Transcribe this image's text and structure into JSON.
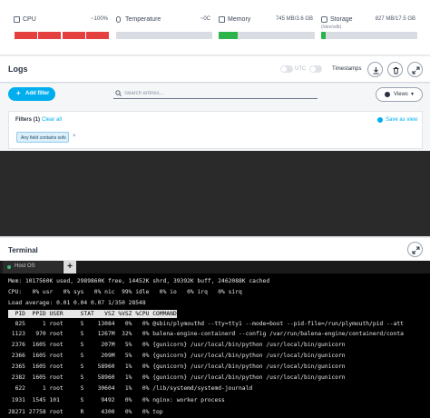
{
  "metrics": [
    {
      "name": "CPU",
      "value": "~100%",
      "sub": "",
      "percent": 100,
      "color": "#e54040",
      "segmented": true,
      "icon": "cpu-icon"
    },
    {
      "name": "Temperature",
      "value": "~0C",
      "sub": "",
      "percent": 0,
      "color": "#d9dde3",
      "segmented": false,
      "icon": "thermometer-icon"
    },
    {
      "name": "Memory",
      "value": "745 MB/3.6 GB",
      "sub": "",
      "percent": 20,
      "color": "#2bb44a",
      "segmented": false,
      "icon": "memory-icon"
    },
    {
      "name": "Storage",
      "value": "827 MB/17.5 GB",
      "sub": "(/dev/sdb)",
      "percent": 5,
      "color": "#2bb44a",
      "segmented": false,
      "icon": "storage-icon"
    }
  ],
  "logs": {
    "title": "Logs",
    "utc_label": "UTC",
    "timestamps_label": "Timestamps",
    "add_filter_label": "Add filter",
    "search_placeholder": "Search entries...",
    "views_label": "Views",
    "filters_title": "Filters (1)",
    "clear_all_label": "Clear all",
    "save_view_label": "Save as view",
    "filter_chip": "Any field contains sofs"
  },
  "terminal": {
    "title": "Terminal",
    "tab_label": "Host OS",
    "lines": [
      "Mem: 1017560K used, 2989860K free, 14452K shrd, 39392K buff, 2462088K cached",
      "CPU:   0% usr   0% sys   0% nic  99% idle   0% io   0% irq   0% sirq",
      "Load average: 0.01 0.04 0.07 1/350 28548",
      "  PID  PPID USER     STAT   VSZ %VSZ %CPU COMMAND",
      "  825     1 root     S    13084   0%   0% @sbin/plymouthd --tty=tty1 --mode=boot --pid-file=/run/plymouth/pid --att",
      " 1123   970 root     S    1267M  32%   0% balena-engine-containerd --config /var/run/balena-engine/containerd/conta",
      " 2376  1605 root     S     207M   5%   0% {gunicorn} /usr/local/bin/python /usr/local/bin/gunicorn",
      " 2366  1605 root     S     209M   5%   0% {gunicorn} /usr/local/bin/python /usr/local/bin/gunicorn",
      " 2365  1605 root     S    58960   1%   0% {gunicorn} /usr/local/bin/python /usr/local/bin/gunicorn",
      " 2382  1605 root     S    58960   1%   0% {gunicorn} /usr/local/bin/python /usr/local/bin/gunicorn",
      "  622     1 root     S    30604   1%   0% /lib/systemd/systemd-journald",
      " 1931  1545 101      S     9492   0%   0% nginx: worker process",
      "28271 27758 root     R     4300   0%   0% top"
    ]
  }
}
